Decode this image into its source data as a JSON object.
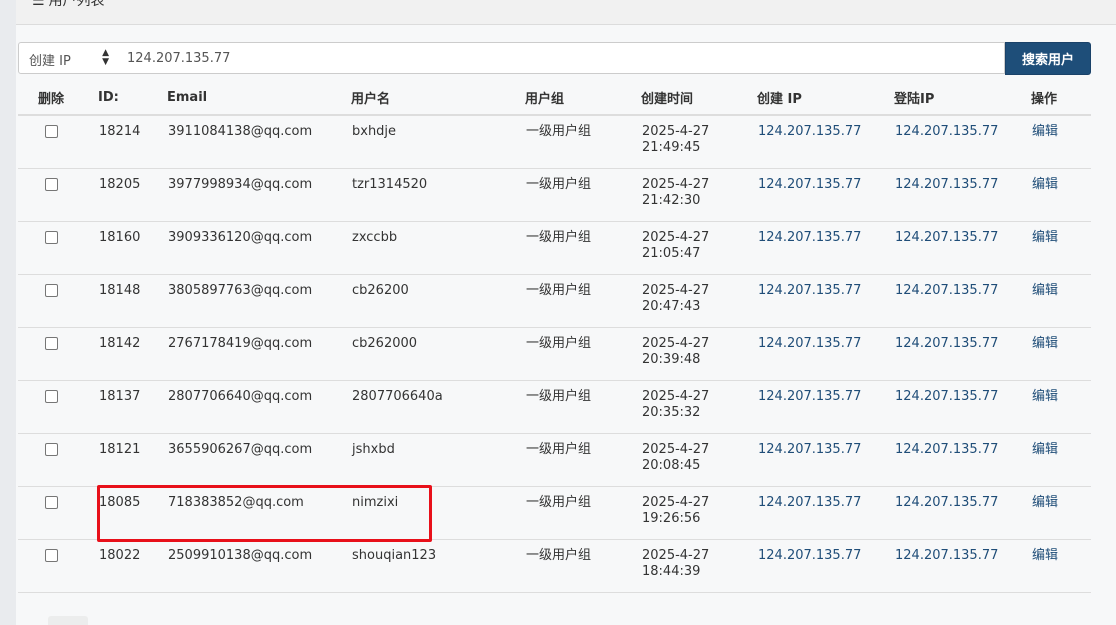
{
  "panel": {
    "title": "用户列表",
    "title_icon": "list-icon"
  },
  "search": {
    "field_selected": "创建 IP",
    "value": "124.207.135.77",
    "button_label": "搜索用户"
  },
  "table": {
    "headers": {
      "delete": "删除",
      "id": "ID:",
      "email": "Email",
      "username": "用户名",
      "group": "用户组",
      "created_time": "创建时间",
      "created_ip": "创建 IP",
      "login_ip": "登陆IP",
      "action": "操作"
    },
    "rows": [
      {
        "id": "18214",
        "email": "3911084138@qq.com",
        "username": "bxhdje",
        "group": "一级用户组",
        "date": "2025-4-27",
        "time": "21:49:45",
        "created_ip": "124.207.135.77",
        "login_ip": "124.207.135.77",
        "action": "编辑"
      },
      {
        "id": "18205",
        "email": "3977998934@qq.com",
        "username": "tzr1314520",
        "group": "一级用户组",
        "date": "2025-4-27",
        "time": "21:42:30",
        "created_ip": "124.207.135.77",
        "login_ip": "124.207.135.77",
        "action": "编辑"
      },
      {
        "id": "18160",
        "email": "3909336120@qq.com",
        "username": "zxccbb",
        "group": "一级用户组",
        "date": "2025-4-27",
        "time": "21:05:47",
        "created_ip": "124.207.135.77",
        "login_ip": "124.207.135.77",
        "action": "编辑"
      },
      {
        "id": "18148",
        "email": "3805897763@qq.com",
        "username": "cb26200",
        "group": "一级用户组",
        "date": "2025-4-27",
        "time": "20:47:43",
        "created_ip": "124.207.135.77",
        "login_ip": "124.207.135.77",
        "action": "编辑"
      },
      {
        "id": "18142",
        "email": "2767178419@qq.com",
        "username": "cb262000",
        "group": "一级用户组",
        "date": "2025-4-27",
        "time": "20:39:48",
        "created_ip": "124.207.135.77",
        "login_ip": "124.207.135.77",
        "action": "编辑"
      },
      {
        "id": "18137",
        "email": "2807706640@qq.com",
        "username": "2807706640a",
        "group": "一级用户组",
        "date": "2025-4-27",
        "time": "20:35:32",
        "created_ip": "124.207.135.77",
        "login_ip": "124.207.135.77",
        "action": "编辑"
      },
      {
        "id": "18121",
        "email": "3655906267@qq.com",
        "username": "jshxbd",
        "group": "一级用户组",
        "date": "2025-4-27",
        "time": "20:08:45",
        "created_ip": "124.207.135.77",
        "login_ip": "124.207.135.77",
        "action": "编辑"
      },
      {
        "id": "18085",
        "email": "718383852@qq.com",
        "username": "nimzixi",
        "group": "一级用户组",
        "date": "2025-4-27",
        "time": "19:26:56",
        "created_ip": "124.207.135.77",
        "login_ip": "124.207.135.77",
        "action": "编辑"
      },
      {
        "id": "18022",
        "email": "2509910138@qq.com",
        "username": "shouqian123",
        "group": "一级用户组",
        "date": "2025-4-27",
        "time": "18:44:39",
        "created_ip": "124.207.135.77",
        "login_ip": "124.207.135.77",
        "action": "编辑"
      }
    ]
  },
  "colors": {
    "primary_button": "#1e4e79",
    "link_text": "#1f4d78",
    "highlight_border": "#e8101a"
  }
}
